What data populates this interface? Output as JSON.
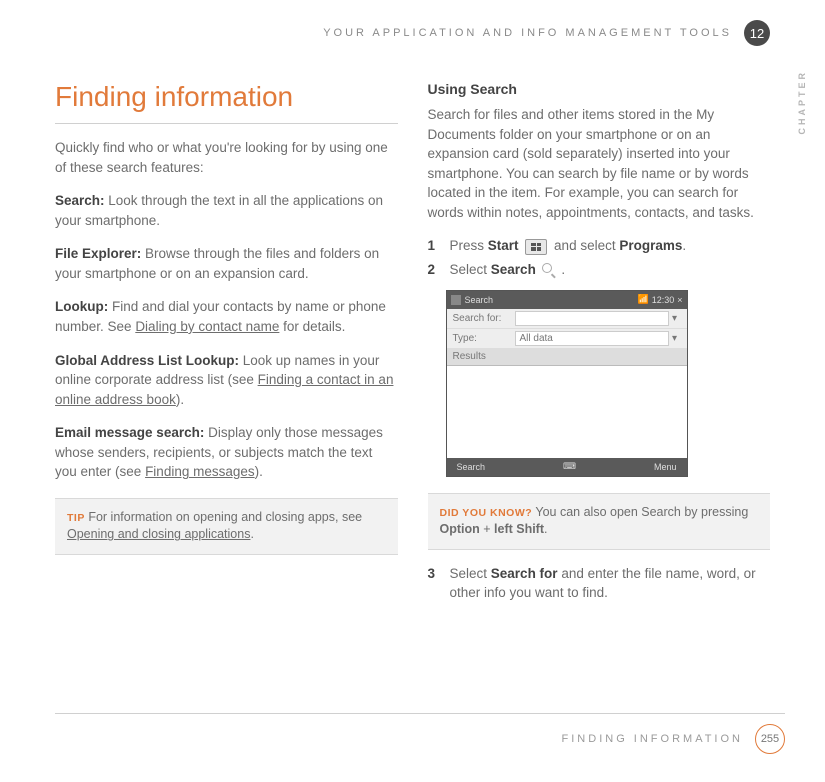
{
  "header": {
    "title": "YOUR APPLICATION AND INFO MANAGEMENT TOOLS",
    "chapter_number": "12",
    "chapter_label": "CHAPTER"
  },
  "left": {
    "title": "Finding information",
    "intro": "Quickly find who or what you're looking for by using one of these search features:",
    "items": [
      {
        "label": "Search:",
        "text": " Look through the text in all the applications on your smartphone."
      },
      {
        "label": "File Explorer:",
        "text": " Browse through the files and folders on your smartphone or on an expansion card."
      },
      {
        "label": "Lookup:",
        "text_before": " Find and dial your contacts by name or phone number. See ",
        "link": "Dialing by contact name",
        "text_after": " for details."
      },
      {
        "label": "Global Address List Lookup:",
        "text_before": " Look up names in your online corporate address list (see ",
        "link": "Finding a contact in an online address book",
        "text_after": ")."
      },
      {
        "label": "Email message search:",
        "text_before": " Display only those messages whose senders, recipients, or subjects match the text you enter (see ",
        "link": "Finding messages",
        "text_after": ")."
      }
    ],
    "tip": {
      "label": "TIP",
      "text_before": "For information on opening and closing apps, see ",
      "link": "Opening and closing applications",
      "text_after": "."
    }
  },
  "right": {
    "heading": "Using Search",
    "intro": "Search for files and other items stored in the My Documents folder on your smartphone or on an expansion card (sold separately) inserted into your smartphone. You can search by file name or by words located in the item. For example, you can search for words within notes, appointments, contacts, and tasks.",
    "step1_a": "Press ",
    "step1_start": "Start",
    "step1_b": " and select ",
    "step1_programs": "Programs",
    "step1_c": ".",
    "step2_a": "Select ",
    "step2_search": "Search",
    "step2_b": " .",
    "screenshot": {
      "title": "Search",
      "time": "12:30",
      "close": "×",
      "row1_label": "Search for:",
      "row2_label": "Type:",
      "row2_value": "All data",
      "results": "Results",
      "foot_left": "Search",
      "foot_right": "Menu"
    },
    "dyk": {
      "label": "DID YOU KNOW?",
      "text_before": "You can also open Search by pressing ",
      "key1": "Option",
      "plus": " + ",
      "key2": "left Shift",
      "text_after": "."
    },
    "step3_a": "Select ",
    "step3_bold": "Search for",
    "step3_b": " and enter the file name, word, or other info you want to find."
  },
  "footer": {
    "title": "FINDING INFORMATION",
    "page": "255"
  }
}
